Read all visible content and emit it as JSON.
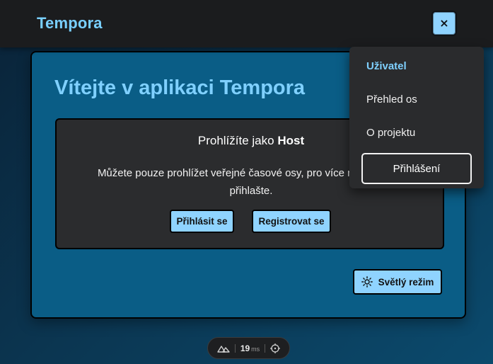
{
  "header": {
    "brand": "Tempora",
    "close_glyph": "×",
    "close_icon": "close-icon"
  },
  "main": {
    "title": "Vítejte v aplikaci Tempora",
    "guest": {
      "heading_prefix": "Prohlížíte jako",
      "heading_role": "Host",
      "text": "Můžete pouze prohlížet veřejné časové osy, pro více možností se přihlašte.",
      "login_label": "Přihlásit se",
      "register_label": "Registrovat se"
    },
    "theme_toggle": {
      "label": "Světlý režim",
      "icon": "sun-icon"
    }
  },
  "menu": {
    "items": [
      {
        "label": "Uživatel",
        "active": true
      },
      {
        "label": "Přehled os",
        "active": false
      },
      {
        "label": "O projektu",
        "active": false
      }
    ],
    "login_label": "Přihlášení"
  },
  "devtools": {
    "render_time": "19",
    "unit": "ms",
    "left_icon": "nuxt-logo-icon",
    "right_icon": "crosshair-icon"
  },
  "colors": {
    "accent": "#79cfff",
    "button": "#8fd3ff",
    "panel": "#0a5d86",
    "card": "#2b2c2e",
    "topbar": "#1b1c1e"
  }
}
